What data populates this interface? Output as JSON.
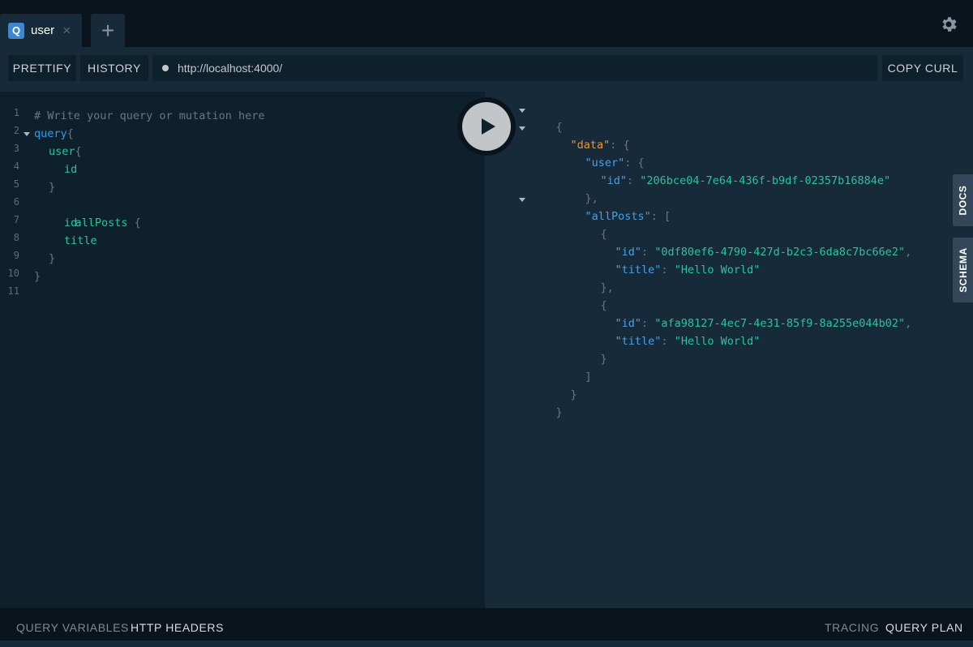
{
  "tab": {
    "badge": "Q",
    "label": "user",
    "close": "×",
    "add": "+"
  },
  "toolbar": {
    "prettify": "PRETTIFY",
    "history": "HISTORY",
    "url": "http://localhost:4000/",
    "copy_curl": "COPY CURL"
  },
  "editor": {
    "line_numbers": [
      "1",
      "2",
      "3",
      "4",
      "5",
      "6",
      "7",
      "8",
      "9",
      "10",
      "11"
    ],
    "lines": {
      "l1": "# Write your query or mutation here",
      "l2_kw": "query",
      "l2_punct": "{",
      "l3_field": "user",
      "l3_punct": "{",
      "l4_field": "id",
      "l5_punct": "}",
      "l6_field": "allPosts",
      "l6_punct": " {",
      "l7_field": "id",
      "l8_field": "title",
      "l9_punct": "}",
      "l10_punct": "}"
    }
  },
  "results": {
    "open_brace": "{",
    "data_key": "\"data\"",
    "colon_brace": ": {",
    "user_key": "\"user\"",
    "user_id_key": "\"id\"",
    "user_id_val": "\"206bce04-7e64-436f-b9df-02357b16884e\"",
    "close_comma": "},",
    "allposts_key": "\"allPosts\"",
    "colon_bracket": ": [",
    "obj_open": "{",
    "post1_id_key": "\"id\"",
    "post1_id_val": "\"0df80ef6-4790-427d-b2c3-6da8c7bc66e2\"",
    "post1_title_key": "\"title\"",
    "post1_title_val": "\"Hello World\"",
    "post2_id_key": "\"id\"",
    "post2_id_val": "\"afa98127-4ec7-4e31-85f9-8a255e044b02\"",
    "post2_title_key": "\"title\"",
    "post2_title_val": "\"Hello World\"",
    "obj_close": "}",
    "array_close": "]",
    "data_close": "}",
    "root_close": "}"
  },
  "side_tabs": {
    "docs": "DOCS",
    "schema": "SCHEMA"
  },
  "bottom": {
    "query_variables": "QUERY VARIABLES",
    "http_headers": "HTTP HEADERS",
    "tracing": "TRACING",
    "query_plan": "QUERY PLAN"
  },
  "colors": {
    "background": "#172a3a",
    "editor_bg": "#0f202d",
    "chrome_bg": "#0b141c",
    "keyword": "#2b9fe0",
    "field": "#28c39d",
    "orange_key": "#e8963a",
    "badge": "#3f86d1"
  }
}
